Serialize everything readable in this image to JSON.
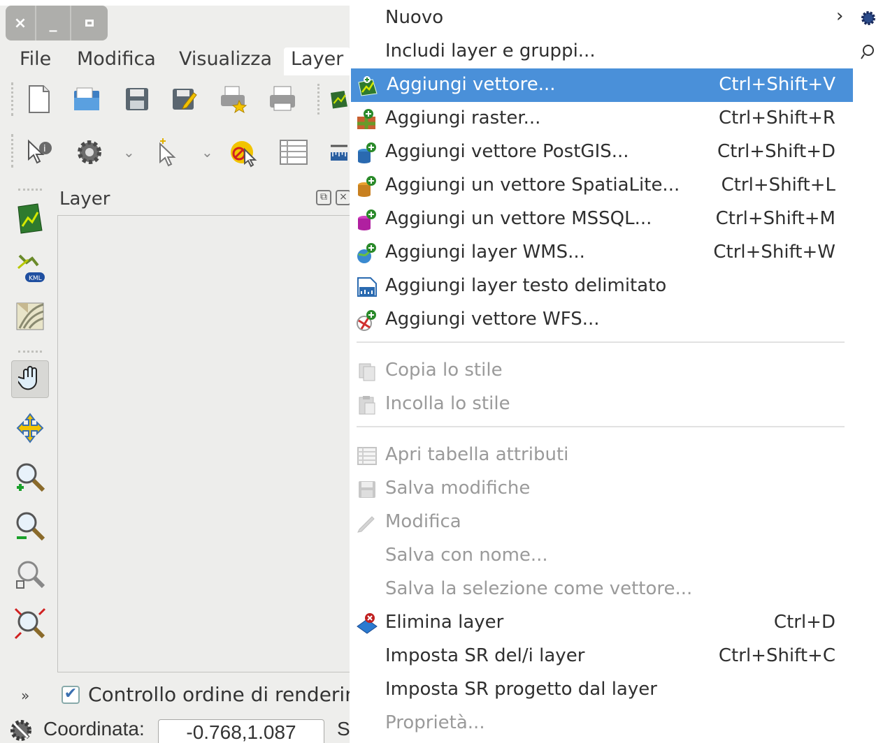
{
  "window": {
    "controls": [
      "×",
      "_",
      "□"
    ]
  },
  "menubar": {
    "items": [
      {
        "label": "File"
      },
      {
        "label": "Modifica"
      },
      {
        "label": "Visualizza"
      },
      {
        "label": "Layer"
      }
    ]
  },
  "toolbar1": {
    "icons": [
      "new-project-icon",
      "open-project-icon",
      "save-project-icon",
      "save-as-icon",
      "print-composer-icon",
      "composer-manager-icon",
      "add-vector-icon"
    ]
  },
  "toolbar2": {
    "icons": [
      "identify-icon",
      "settings-icon",
      "select-icon",
      "deselect-icon",
      "attribute-table-icon",
      "measure-icon"
    ]
  },
  "sidebar": {
    "icons": [
      "add-vector-layer-icon",
      "add-kml-icon",
      "add-raster-icon",
      "pan-icon",
      "pan-to-selection-icon",
      "zoom-in-icon",
      "zoom-out-icon",
      "zoom-layer-icon",
      "zoom-full-icon"
    ]
  },
  "layers_panel": {
    "title": "Layer",
    "float_symbol": "⧉",
    "close_symbol": "×"
  },
  "render_order": {
    "expand": "»",
    "checked": true,
    "check_mark": "✔",
    "label": "Controllo ordine di rendering"
  },
  "statusbar": {
    "coord_label": "Coordinata:",
    "coord_value": "-0.768,1.087",
    "scale_label": "S"
  },
  "layer_menu": {
    "items": [
      {
        "label": "Nuovo",
        "shortcut": "",
        "submenu": true,
        "arrow": "›"
      },
      {
        "label": "Includi layer e gruppi...",
        "shortcut": ""
      },
      {
        "label": "Aggiungi vettore...",
        "shortcut": "Ctrl+Shift+V",
        "highlighted": true
      },
      {
        "label": "Aggiungi raster...",
        "shortcut": "Ctrl+Shift+R"
      },
      {
        "label": "Aggiungi vettore PostGIS...",
        "shortcut": "Ctrl+Shift+D"
      },
      {
        "label": "Aggiungi un vettore SpatiaLite...",
        "shortcut": "Ctrl+Shift+L"
      },
      {
        "label": "Aggiungi un vettore MSSQL...",
        "shortcut": "Ctrl+Shift+M"
      },
      {
        "label": "Aggiungi layer WMS...",
        "shortcut": "Ctrl+Shift+W"
      },
      {
        "label": "Aggiungi layer testo delimitato",
        "shortcut": ""
      },
      {
        "label": "Aggiungi vettore WFS...",
        "shortcut": ""
      },
      {
        "label": "Copia lo stile",
        "shortcut": "",
        "disabled": true
      },
      {
        "label": "Incolla lo stile",
        "shortcut": "",
        "disabled": true
      },
      {
        "label": "Apri tabella attributi",
        "shortcut": "",
        "disabled": true
      },
      {
        "label": "Salva modifiche",
        "shortcut": "",
        "disabled": true
      },
      {
        "label": "Modifica",
        "shortcut": "",
        "disabled": true
      },
      {
        "label": "Salva con nome...",
        "shortcut": "",
        "disabled": true
      },
      {
        "label": "Salva la selezione come vettore...",
        "shortcut": "",
        "disabled": true
      },
      {
        "label": "Elimina layer",
        "shortcut": "Ctrl+D"
      },
      {
        "label": "Imposta SR del/i layer",
        "shortcut": "Ctrl+Shift+C"
      },
      {
        "label": "Imposta SR progetto dal layer",
        "shortcut": ""
      },
      {
        "label": "Proprietà...",
        "shortcut": "",
        "disabled": true
      }
    ]
  },
  "colors": {
    "highlight": "#4a90d9",
    "menu_bg": "#ffffff",
    "window_bg": "#eeeeec",
    "disabled_text": "#9a9a9a"
  }
}
